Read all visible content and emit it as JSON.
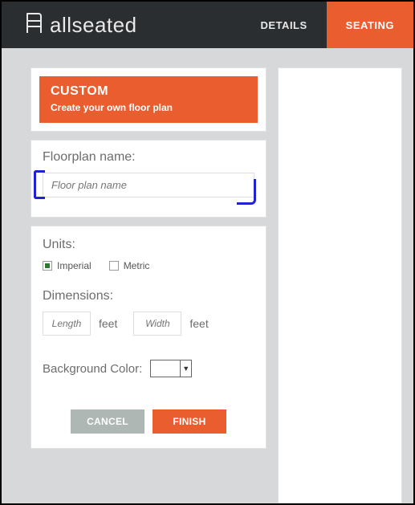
{
  "brand": {
    "name": "allseated"
  },
  "nav": {
    "details": "DETAILS",
    "seating": "SEATING",
    "active": "seating"
  },
  "cta": {
    "title": "CUSTOM",
    "subtitle": "Create your own floor plan"
  },
  "floorplan": {
    "label": "Floorplan name:",
    "placeholder": "Floor plan name",
    "value": ""
  },
  "units": {
    "label": "Units:",
    "options": {
      "imperial": "Imperial",
      "metric": "Metric"
    },
    "selected": "imperial"
  },
  "dimensions": {
    "label": "Dimensions:",
    "length_placeholder": "Length",
    "length_value": "",
    "width_placeholder": "Width",
    "width_value": "",
    "unit_label": "feet"
  },
  "background": {
    "label": "Background Color:",
    "value": "#ffffff"
  },
  "buttons": {
    "cancel": "CANCEL",
    "finish": "FINISH"
  }
}
